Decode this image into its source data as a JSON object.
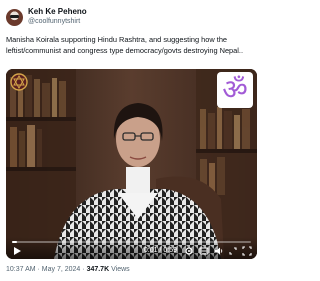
{
  "author": {
    "display_name": "Keh Ke Peheno",
    "handle": "@coolfunnytshirt"
  },
  "tweet": {
    "text": "Manisha Koirala supporting Hindu Rashtra, and suggesting how the leftist/communist and congress type democracy/govts destroying Nepal..",
    "timestamp": "10:37 AM · May 7, 2024 ·",
    "views_count": "347.7K",
    "views_label": "Views"
  },
  "video": {
    "overlay_symbol": "ॐ",
    "overlay_color": "#a25bd6",
    "time_display": "0:01 / 0:59",
    "progress": 0.02,
    "controls": {
      "play_icon": "play-icon",
      "settings_icon": "gear-icon",
      "captions_icon": "captions-icon",
      "volume_icon": "volume-icon",
      "expand_icon": "expand-icon",
      "fullscreen_icon": "fullscreen-icon"
    }
  }
}
